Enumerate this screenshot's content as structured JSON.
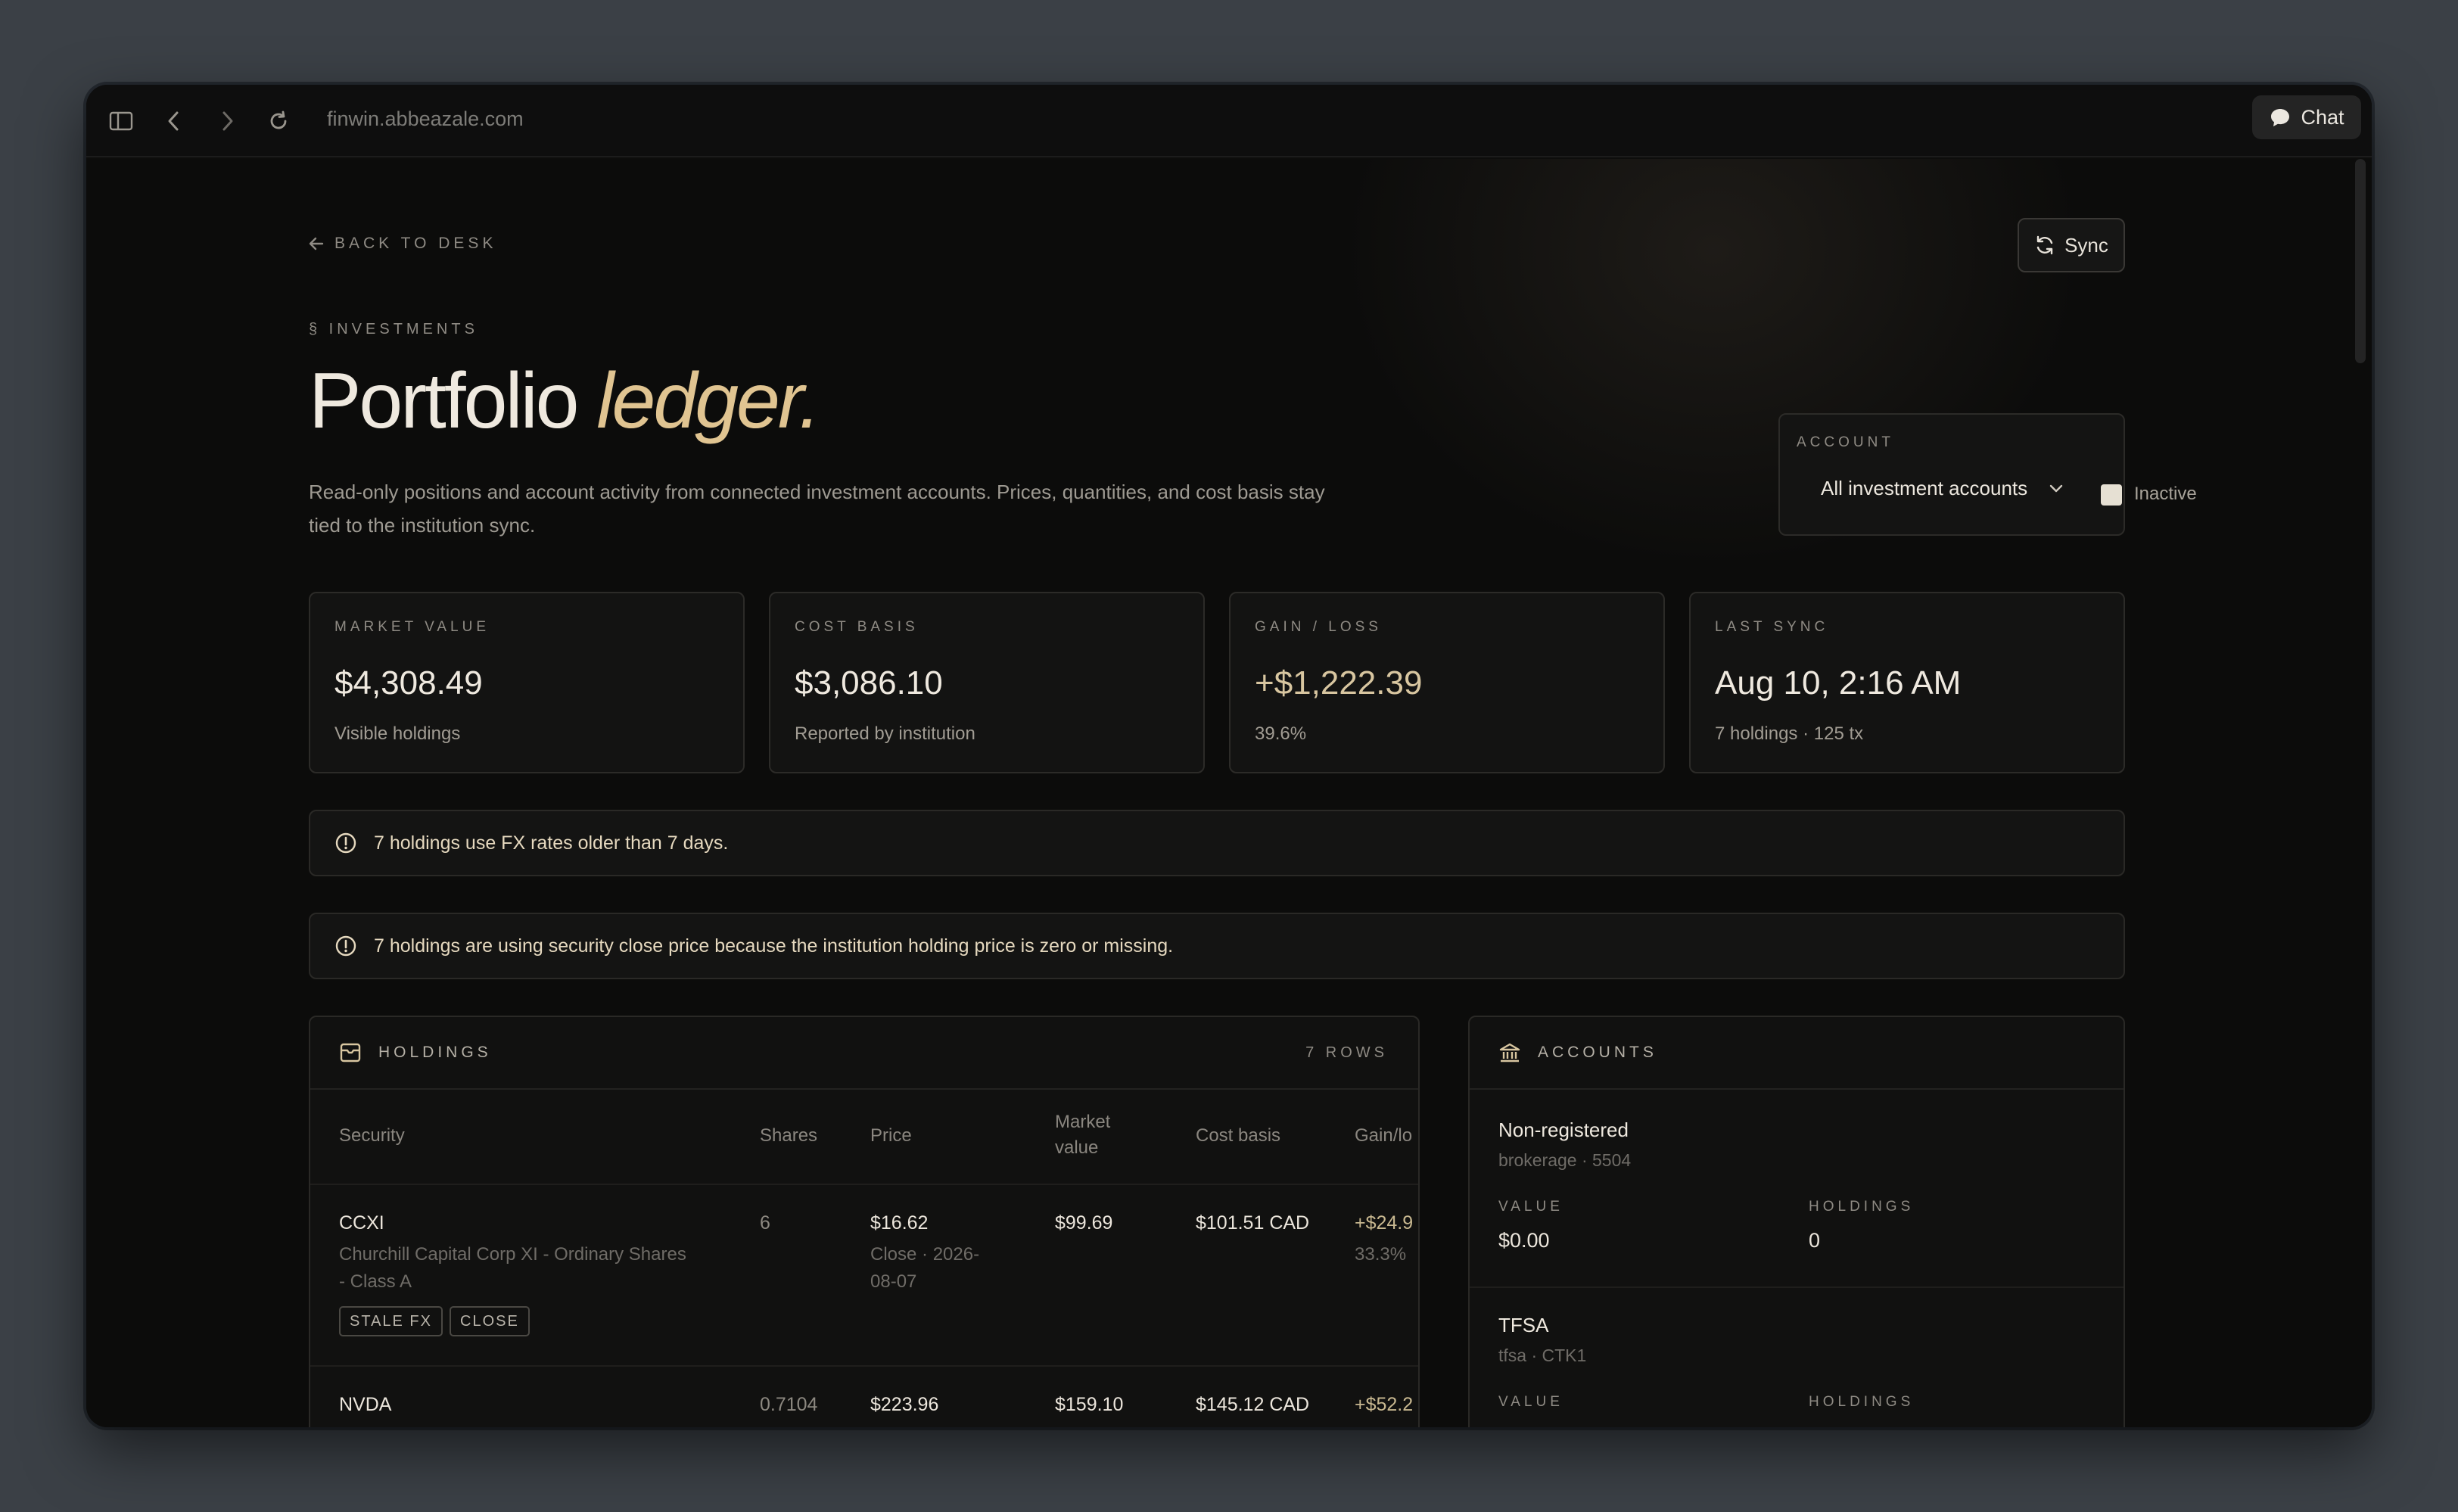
{
  "browser": {
    "url": "finwin.abbeazale.com",
    "chat_label": "Chat"
  },
  "header": {
    "back_label": "BACK TO DESK",
    "sync_label": "Sync",
    "eyebrow": "§ INVESTMENTS",
    "title_main": "Portfolio ",
    "title_accent": "ledger.",
    "description": "Read-only positions and account activity from connected investment accounts. Prices, quantities, and cost basis stay tied to the institution sync."
  },
  "account_filter": {
    "label": "ACCOUNT",
    "selected": "All investment accounts",
    "inactive_label": "Inactive",
    "inactive_checked": false
  },
  "stats": [
    {
      "label": "MARKET VALUE",
      "value": "$4,308.49",
      "sub": "Visible holdings"
    },
    {
      "label": "COST BASIS",
      "value": "$3,086.10",
      "sub": "Reported by institution"
    },
    {
      "label": "GAIN / LOSS",
      "value": "+$1,222.39",
      "sub": "39.6%"
    },
    {
      "label": "LAST SYNC",
      "value": "Aug 10, 2:16 AM",
      "sub": "7 holdings · 125 tx"
    }
  ],
  "alerts": [
    "7 holdings use FX rates older than 7 days.",
    "7 holdings are using security close price because the institution holding price is zero or missing."
  ],
  "holdings": {
    "title": "HOLDINGS",
    "row_count": "7 ROWS",
    "columns": [
      "Security",
      "Shares",
      "Price",
      "Market\nvalue",
      "Cost basis",
      "Gain/lo"
    ],
    "rows": [
      {
        "symbol": "CCXI",
        "name_line1": "Churchill Capital Corp XI - Ordinary Shares",
        "name_line2": "- Class A",
        "shares": "6",
        "price": "$16.62",
        "price_note_1": "Close · 2026-",
        "price_note_2": "08-07",
        "market_value": "$99.69",
        "cost_basis": "$101.51 CAD",
        "gain": "+$24.9",
        "gain_pct": "33.3%",
        "tags": [
          "STALE FX",
          "CLOSE"
        ]
      },
      {
        "symbol": "NVDA",
        "shares": "0.7104",
        "price": "$223.96",
        "market_value": "$159.10",
        "cost_basis": "$145.12 CAD",
        "gain": "+$52.2"
      }
    ]
  },
  "accounts": {
    "title": "ACCOUNTS",
    "items": [
      {
        "name": "Non-registered",
        "sub": "brokerage · 5504",
        "value_label": "VALUE",
        "value": "$0.00",
        "holdings_label": "HOLDINGS",
        "holdings": "0"
      },
      {
        "name": "TFSA",
        "sub": "tfsa · CTK1",
        "value_label": "VALUE",
        "holdings_label": "HOLDINGS"
      }
    ]
  }
}
